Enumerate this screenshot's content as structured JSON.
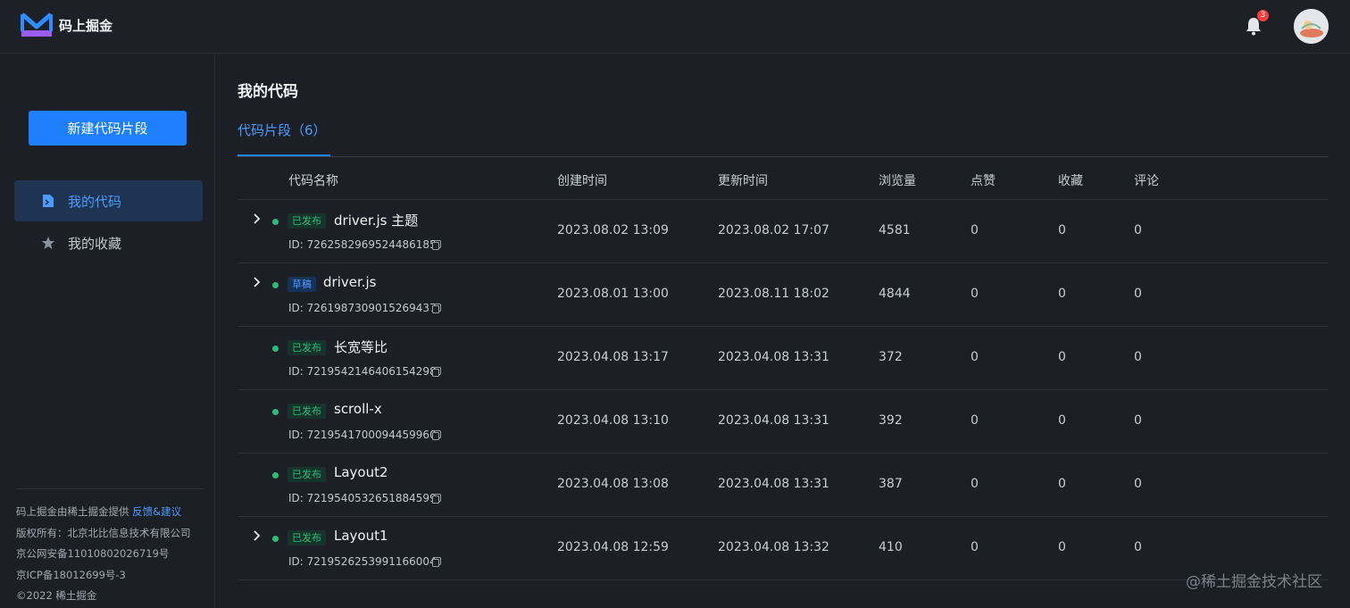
{
  "header": {
    "logo_text": "码上掘金",
    "notification_count": "3",
    "brand_color": "#1e80ff"
  },
  "sidebar": {
    "new_button_label": "新建代码片段",
    "items": [
      {
        "label": "我的代码",
        "icon": "code-file-icon",
        "active": true
      },
      {
        "label": "我的收藏",
        "icon": "star-icon",
        "active": false
      }
    ],
    "footer": {
      "line1_prefix": "码上掘金由稀土掘金提供",
      "line1_link": "反馈&建议",
      "line2": "版权所有：北京北比信息技术有限公司",
      "line3": "京公网安备11010802026719号",
      "line4": "京ICP备18012699号-3",
      "line5": "©2022 稀土掘金"
    }
  },
  "main": {
    "title": "我的代码",
    "tab_label": "代码片段（6）",
    "columns": [
      "代码名称",
      "创建时间",
      "更新时间",
      "浏览量",
      "点赞",
      "收藏",
      "评论"
    ],
    "rows": [
      {
        "expandable": true,
        "status": "已发布",
        "status_type": "published",
        "name": "driver.js 主题",
        "id": "ID: 7262582969524486185",
        "created": "2023.08.02 13:09",
        "updated": "2023.08.02 17:07",
        "views": "4581",
        "likes": "0",
        "favorites": "0",
        "comments": "0"
      },
      {
        "expandable": true,
        "status": "草稿",
        "status_type": "draft",
        "name": "driver.js",
        "id": "ID: 7261987309015269437",
        "created": "2023.08.01 13:00",
        "updated": "2023.08.11 18:02",
        "views": "4844",
        "likes": "0",
        "favorites": "0",
        "comments": "0"
      },
      {
        "expandable": false,
        "status": "已发布",
        "status_type": "published",
        "name": "长宽等比",
        "id": "ID: 7219542146406154298",
        "created": "2023.04.08 13:17",
        "updated": "2023.04.08 13:31",
        "views": "372",
        "likes": "0",
        "favorites": "0",
        "comments": "0"
      },
      {
        "expandable": false,
        "status": "已发布",
        "status_type": "published",
        "name": "scroll-x",
        "id": "ID: 7219541700094459960",
        "created": "2023.04.08 13:10",
        "updated": "2023.04.08 13:31",
        "views": "392",
        "likes": "0",
        "favorites": "0",
        "comments": "0"
      },
      {
        "expandable": false,
        "status": "已发布",
        "status_type": "published",
        "name": "Layout2",
        "id": "ID: 7219540532651884599",
        "created": "2023.04.08 13:08",
        "updated": "2023.04.08 13:31",
        "views": "387",
        "likes": "0",
        "favorites": "0",
        "comments": "0"
      },
      {
        "expandable": true,
        "status": "已发布",
        "status_type": "published",
        "name": "Layout1",
        "id": "ID: 7219526253991166004",
        "created": "2023.04.08 12:59",
        "updated": "2023.04.08 13:32",
        "views": "410",
        "likes": "0",
        "favorites": "0",
        "comments": "0"
      }
    ]
  },
  "watermark": "@稀土掘金技术社区"
}
